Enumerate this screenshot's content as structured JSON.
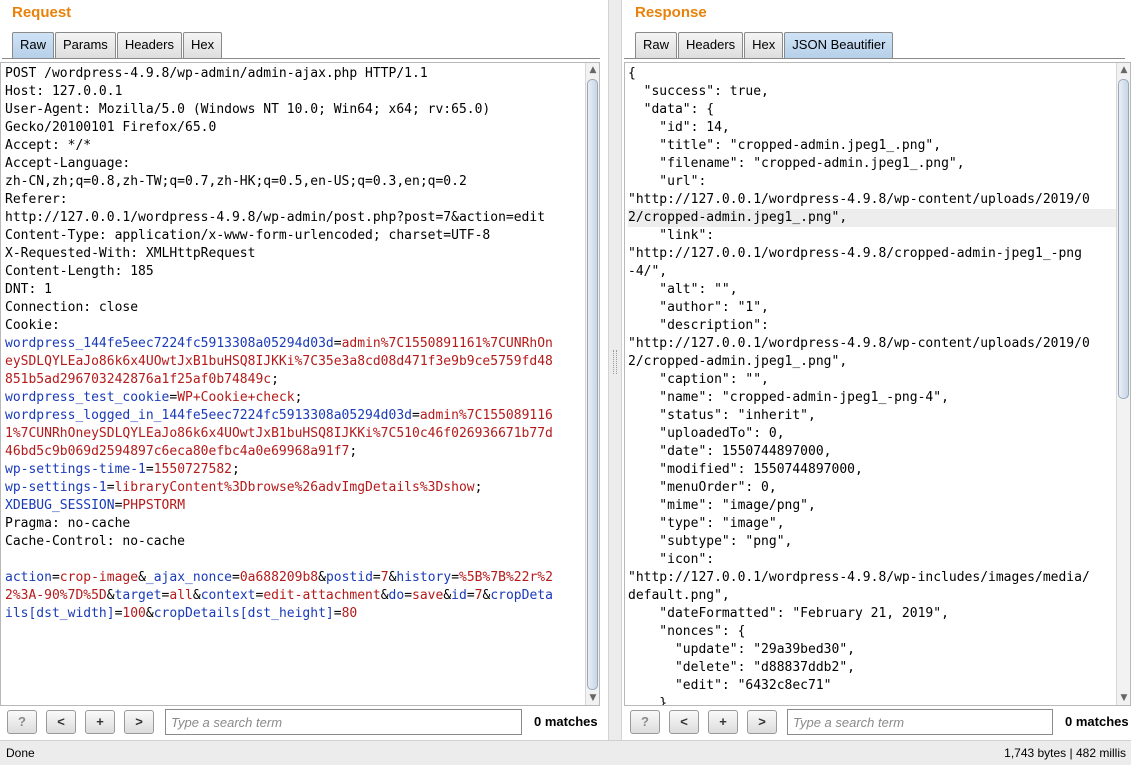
{
  "request": {
    "title": "Request",
    "tabs": [
      {
        "label": "Raw",
        "active": true
      },
      {
        "label": "Params",
        "active": false
      },
      {
        "label": "Headers",
        "active": false
      },
      {
        "label": "Hex",
        "active": false
      }
    ],
    "lines": [
      [
        {
          "t": "POST /wordpress-4.9.8/wp-admin/admin-ajax.php HTTP/1.1"
        }
      ],
      [
        {
          "t": "Host: 127.0.0.1"
        }
      ],
      [
        {
          "t": "User-Agent: Mozilla/5.0 (Windows NT 10.0; Win64; x64; rv:65.0)"
        }
      ],
      [
        {
          "t": "Gecko/20100101 Firefox/65.0"
        }
      ],
      [
        {
          "t": "Accept: */*"
        }
      ],
      [
        {
          "t": "Accept-Language:"
        }
      ],
      [
        {
          "t": "zh-CN,zh;q=0.8,zh-TW;q=0.7,zh-HK;q=0.5,en-US;q=0.3,en;q=0.2"
        }
      ],
      [
        {
          "t": "Referer:"
        }
      ],
      [
        {
          "t": "http://127.0.0.1/wordpress-4.9.8/wp-admin/post.php?post=7&action=edit"
        }
      ],
      [
        {
          "t": "Content-Type: application/x-www-form-urlencoded; charset=UTF-8"
        }
      ],
      [
        {
          "t": "X-Requested-With: XMLHttpRequest"
        }
      ],
      [
        {
          "t": "Content-Length: 185"
        }
      ],
      [
        {
          "t": "DNT: 1"
        }
      ],
      [
        {
          "t": "Connection: close"
        }
      ],
      [
        {
          "t": "Cookie:"
        }
      ],
      [
        {
          "t": "wordpress_144fe5eec7224fc5913308a05294d03d",
          "c": "k"
        },
        {
          "t": "="
        },
        {
          "t": "admin%7C1550891161%7CUNRhOn",
          "c": "v"
        }
      ],
      [
        {
          "t": "eySDLQYLEaJo86k6x4UOwtJxB1buHSQ8IJKKi%7C35e3a8cd08d471f3e9b9ce5759fd48",
          "c": "v"
        }
      ],
      [
        {
          "t": "851b5ad296703242876a1f25af0b74849c",
          "c": "v"
        },
        {
          "t": ";"
        }
      ],
      [
        {
          "t": "wordpress_test_cookie",
          "c": "k"
        },
        {
          "t": "="
        },
        {
          "t": "WP+Cookie+check",
          "c": "v"
        },
        {
          "t": ";"
        }
      ],
      [
        {
          "t": "wordpress_logged_in_144fe5eec7224fc5913308a05294d03d",
          "c": "k"
        },
        {
          "t": "="
        },
        {
          "t": "admin%7C155089116",
          "c": "v"
        }
      ],
      [
        {
          "t": "1%7CUNRhOneySDLQYLEaJo86k6x4UOwtJxB1buHSQ8IJKKi%7C510c46f026936671b77d",
          "c": "v"
        }
      ],
      [
        {
          "t": "46bd5c9b069d2594897c6eca80efbc4a0e69968a91f7",
          "c": "v"
        },
        {
          "t": ";"
        }
      ],
      [
        {
          "t": "wp-settings-time-1",
          "c": "k"
        },
        {
          "t": "="
        },
        {
          "t": "1550727582",
          "c": "v"
        },
        {
          "t": ";"
        }
      ],
      [
        {
          "t": "wp-settings-1",
          "c": "k"
        },
        {
          "t": "="
        },
        {
          "t": "libraryContent%3Dbrowse%26advImgDetails%3Dshow",
          "c": "v"
        },
        {
          "t": ";"
        }
      ],
      [
        {
          "t": "XDEBUG_SESSION",
          "c": "k"
        },
        {
          "t": "="
        },
        {
          "t": "PHPSTORM",
          "c": "v"
        }
      ],
      [
        {
          "t": "Pragma: no-cache"
        }
      ],
      [
        {
          "t": "Cache-Control: no-cache"
        }
      ],
      [
        {
          "t": ""
        }
      ],
      [
        {
          "t": "action",
          "c": "k"
        },
        {
          "t": "="
        },
        {
          "t": "crop-image",
          "c": "v"
        },
        {
          "t": "&"
        },
        {
          "t": "_ajax_nonce",
          "c": "k"
        },
        {
          "t": "="
        },
        {
          "t": "0a688209b8",
          "c": "v"
        },
        {
          "t": "&"
        },
        {
          "t": "postid",
          "c": "k"
        },
        {
          "t": "="
        },
        {
          "t": "7",
          "c": "v"
        },
        {
          "t": "&"
        },
        {
          "t": "history",
          "c": "k"
        },
        {
          "t": "="
        },
        {
          "t": "%5B%7B%22r%2",
          "c": "v"
        }
      ],
      [
        {
          "t": "2%3A-90%7D%5D",
          "c": "v"
        },
        {
          "t": "&"
        },
        {
          "t": "target",
          "c": "k"
        },
        {
          "t": "="
        },
        {
          "t": "all",
          "c": "v"
        },
        {
          "t": "&"
        },
        {
          "t": "context",
          "c": "k"
        },
        {
          "t": "="
        },
        {
          "t": "edit-attachment",
          "c": "v"
        },
        {
          "t": "&"
        },
        {
          "t": "do",
          "c": "k"
        },
        {
          "t": "="
        },
        {
          "t": "save",
          "c": "v"
        },
        {
          "t": "&"
        },
        {
          "t": "id",
          "c": "k"
        },
        {
          "t": "="
        },
        {
          "t": "7",
          "c": "v"
        },
        {
          "t": "&"
        },
        {
          "t": "cropDeta",
          "c": "k"
        }
      ],
      [
        {
          "t": "ils[dst_width]",
          "c": "k"
        },
        {
          "t": "="
        },
        {
          "t": "100",
          "c": "v"
        },
        {
          "t": "&"
        },
        {
          "t": "cropDetails[dst_height]",
          "c": "k"
        },
        {
          "t": "="
        },
        {
          "t": "80",
          "c": "v"
        }
      ]
    ],
    "search": {
      "placeholder": "Type a search term",
      "matches": "0 matches",
      "help": "?",
      "prev": "<",
      "add": "+",
      "next": ">"
    }
  },
  "response": {
    "title": "Response",
    "tabs": [
      {
        "label": "Raw",
        "active": false
      },
      {
        "label": "Headers",
        "active": false
      },
      {
        "label": "Hex",
        "active": false
      },
      {
        "label": "JSON Beautifier",
        "active": true
      }
    ],
    "lines": [
      "{",
      "  \"success\": true,",
      "  \"data\": {",
      "    \"id\": 14,",
      "    \"title\": \"cropped-admin.jpeg1_.png\",",
      "    \"filename\": \"cropped-admin.jpeg1_.png\",",
      "    \"url\":",
      "\"http://127.0.0.1/wordpress-4.9.8/wp-content/uploads/2019/0",
      "2/cropped-admin.jpeg1_.png\",",
      "    \"link\":",
      "\"http://127.0.0.1/wordpress-4.9.8/cropped-admin-jpeg1_-png",
      "-4/\",",
      "    \"alt\": \"\",",
      "    \"author\": \"1\",",
      "    \"description\":",
      "\"http://127.0.0.1/wordpress-4.9.8/wp-content/uploads/2019/0",
      "2/cropped-admin.jpeg1_.png\",",
      "    \"caption\": \"\",",
      "    \"name\": \"cropped-admin-jpeg1_-png-4\",",
      "    \"status\": \"inherit\",",
      "    \"uploadedTo\": 0,",
      "    \"date\": 1550744897000,",
      "    \"modified\": 1550744897000,",
      "    \"menuOrder\": 0,",
      "    \"mime\": \"image/png\",",
      "    \"type\": \"image\",",
      "    \"subtype\": \"png\",",
      "    \"icon\":",
      "\"http://127.0.0.1/wordpress-4.9.8/wp-includes/images/media/",
      "default.png\",",
      "    \"dateFormatted\": \"February 21, 2019\",",
      "    \"nonces\": {",
      "      \"update\": \"29a39bed30\",",
      "      \"delete\": \"d88837ddb2\",",
      "      \"edit\": \"6432c8ec71\"",
      "    }"
    ],
    "highlight_line": 8,
    "search": {
      "placeholder": "Type a search term",
      "matches": "0 matches",
      "help": "?",
      "prev": "<",
      "add": "+",
      "next": ">"
    }
  },
  "status": {
    "left": "Done",
    "right": "1,743 bytes | 482 millis"
  },
  "colors": {
    "title": "#e8820b",
    "key": "#1a3bb8",
    "value": "#b51a1a",
    "active_tab": "#b4cfe8"
  }
}
